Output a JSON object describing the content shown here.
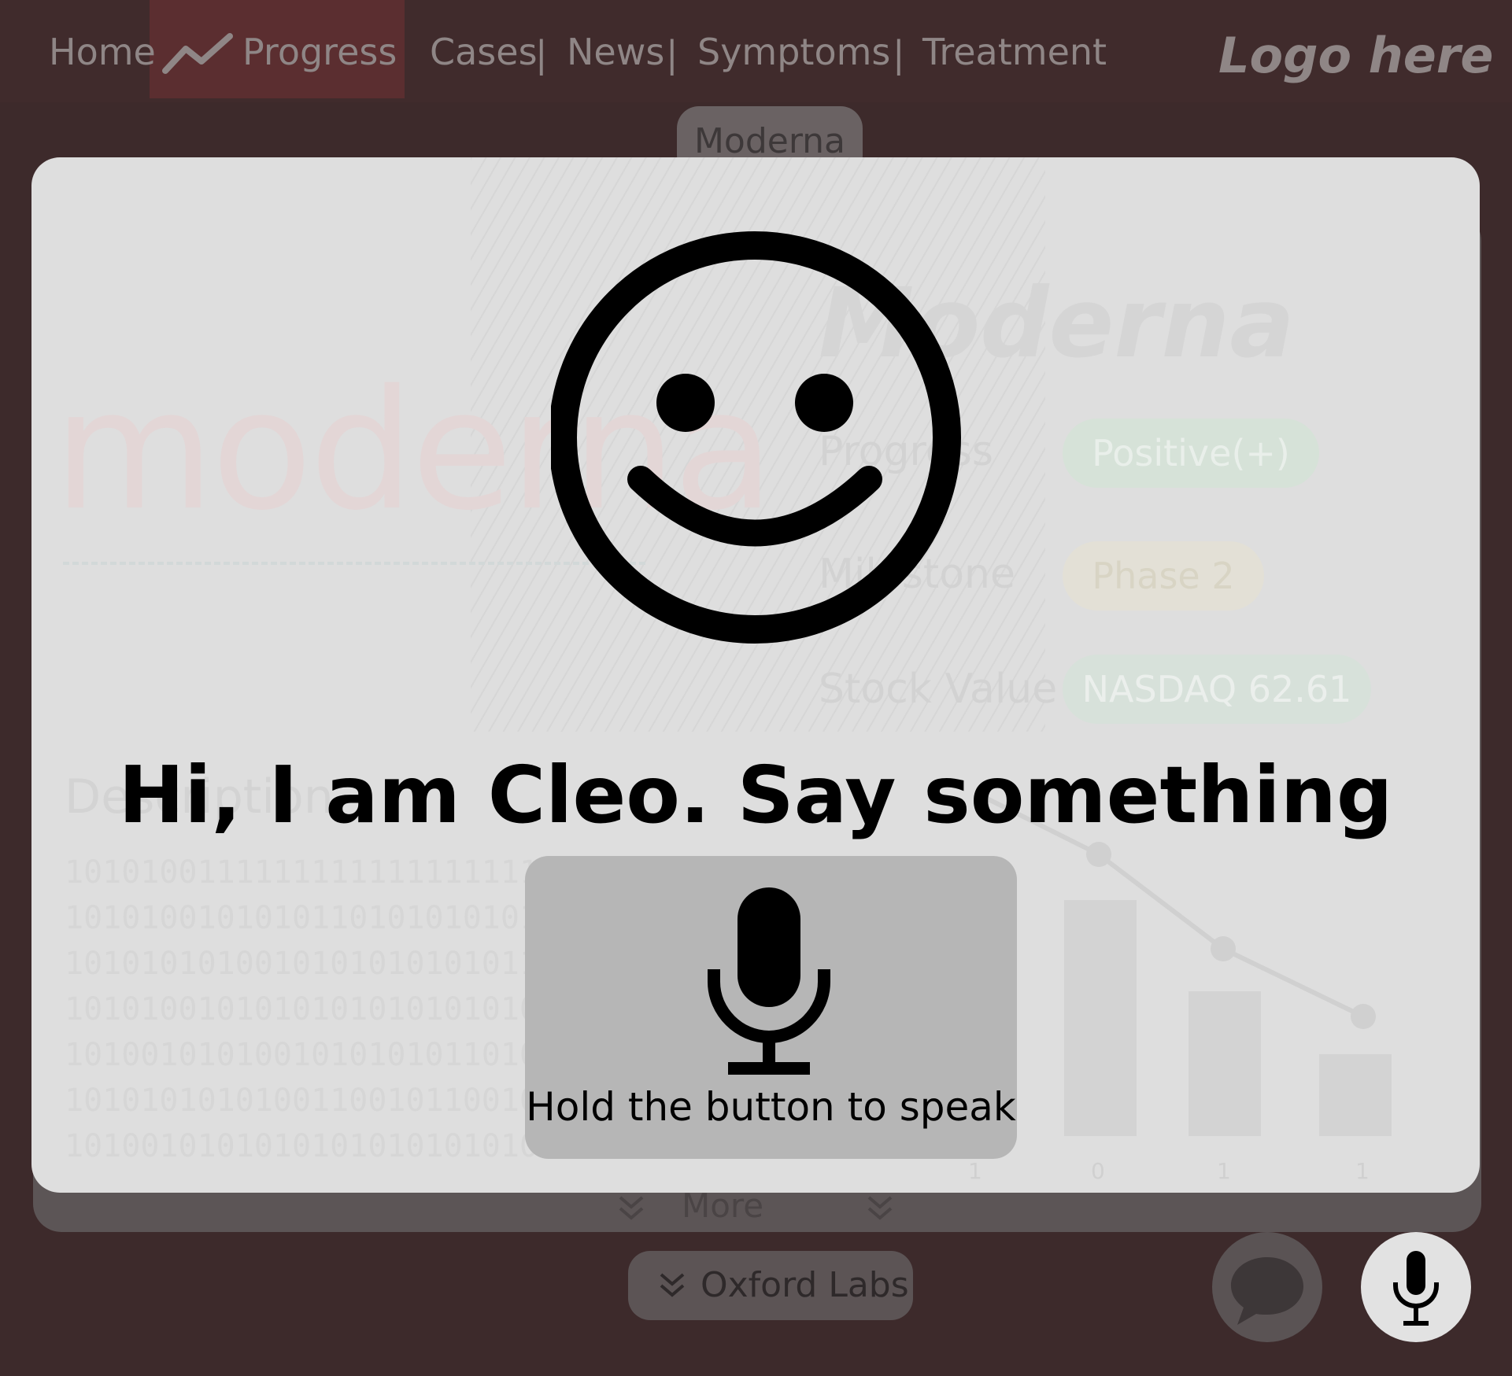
{
  "nav": {
    "items": [
      "Home",
      "Progress",
      "Cases",
      "News",
      "Symptoms",
      "Treatment"
    ],
    "active": "Progress",
    "separator": "|",
    "logo": "Logo here",
    "progress_icon": "trend-line-icon"
  },
  "company_tab": "Moderna",
  "background_card": {
    "wordmark": "moderna",
    "title": "Moderna",
    "rows": [
      {
        "label": "Progress",
        "value": "Positive(+)"
      },
      {
        "label": "Milestone",
        "value": "Phase 2"
      },
      {
        "label": "Stock Value",
        "value": "NASDAQ 62.61"
      }
    ],
    "description_heading": "Description",
    "description_lines": [
      "1010100111111111111111111111010",
      "1010100101010110101010101010101",
      "1010101010010101010101011001010",
      "1010100101010101010101010101010",
      "1010010101001010101011010100101",
      "1010101010100110010110010101010",
      "1010010101010101010101010101010"
    ],
    "chart_axis_labels": [
      "1",
      "0",
      "1",
      "1"
    ],
    "more_label": "More"
  },
  "next_section_label": "Oxford Labs",
  "assistant": {
    "greeting": "Hi, I am Cleo. Say something",
    "face_icon": "smiley-face-icon",
    "speak_button_label": "Hold the button to speak",
    "speak_icon": "microphone-icon"
  },
  "fabs": {
    "chat_icon": "chat-bubble-icon",
    "mic_icon": "microphone-icon"
  },
  "colors": {
    "page_background": "#3d2a2b",
    "nav_active": "#5b2e30",
    "modal_background": "#dedede",
    "speak_button": "#b6b6b6",
    "pill_positive": "#cfe2d4",
    "pill_milestone": "#e7e2d2"
  }
}
